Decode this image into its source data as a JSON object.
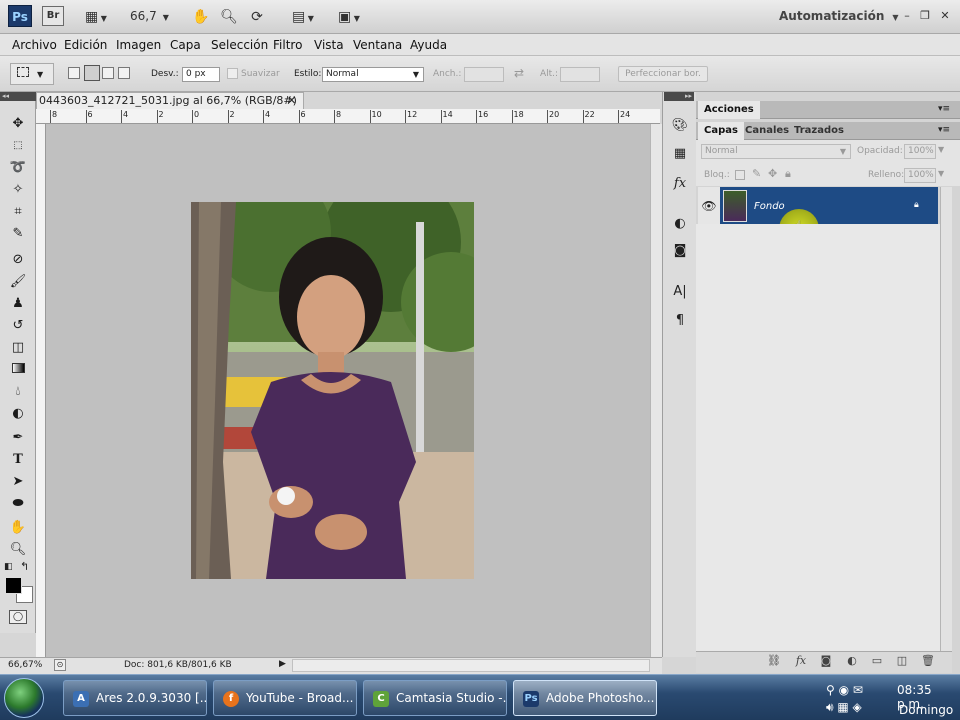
{
  "appbar": {
    "ps_label": "Ps",
    "br_label": "Br",
    "zoom": "66,7",
    "workspace": "Automatización"
  },
  "menu": [
    "Archivo",
    "Edición",
    "Imagen",
    "Capa",
    "Selección",
    "Filtro",
    "Vista",
    "Ventana",
    "Ayuda"
  ],
  "options": {
    "feather_label": "Desv.:",
    "feather_value": "0 px",
    "antialias_label": "Suavizar",
    "style_label": "Estilo:",
    "style_value": "Normal",
    "width_label": "Anch.:",
    "height_label": "Alt.:",
    "refine_label": "Perfeccionar bor."
  },
  "document": {
    "tab_title": "0443603_412721_5031.jpg al 66,7% (RGB/8#)",
    "ruler_ticks": [
      "8",
      "6",
      "4",
      "2",
      "0",
      "2",
      "4",
      "6",
      "8",
      "10",
      "12",
      "14",
      "16",
      "18",
      "20",
      "22",
      "24"
    ],
    "zoom_status": "66,67%",
    "doc_status": "Doc: 801,6 KB/801,6 KB"
  },
  "panels": {
    "actions_tab": "Acciones",
    "layer_tabs": [
      "Capas",
      "Canales",
      "Trazados"
    ],
    "blend_mode": "Normal",
    "opacity_label": "Opacidad:",
    "opacity_value": "100%",
    "lock_label": "Bloq.:",
    "fill_label": "Relleno:",
    "fill_value": "100%",
    "layer_name": "Fondo"
  },
  "taskbar": {
    "tasks": [
      "Ares 2.0.9.3030   [...",
      "YouTube - Broad...",
      "Camtasia Studio -...",
      "Adobe Photosho..."
    ],
    "time": "08:35 p.m.",
    "day": "Domingo"
  },
  "colors": {
    "layer_selected": "#1e4b85",
    "canvas_bg": "#c0c0c0",
    "taskbar": "#2a4a71"
  }
}
